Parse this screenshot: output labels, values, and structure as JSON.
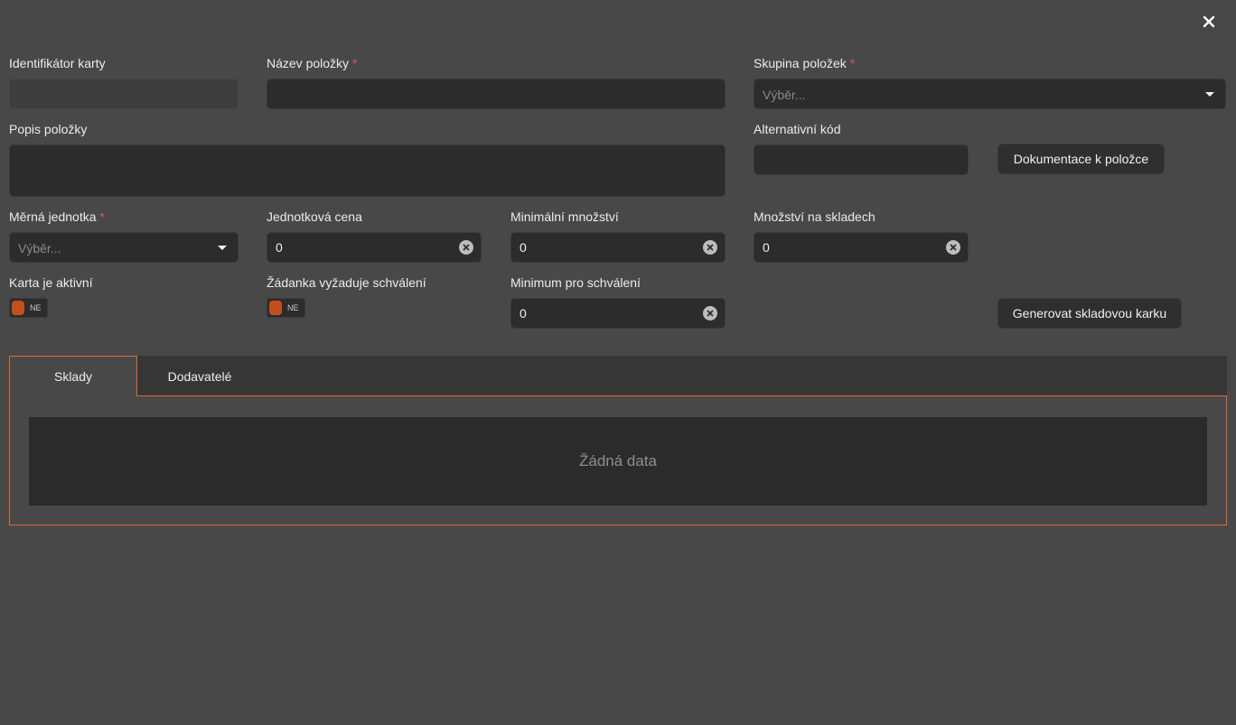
{
  "form": {
    "card_id": {
      "label": "Identifikátor karty",
      "value": ""
    },
    "item_name": {
      "label": "Název položky",
      "required_mark": "*",
      "value": ""
    },
    "item_group": {
      "label": "Skupina položek",
      "required_mark": "*",
      "placeholder": "Výběr..."
    },
    "item_description": {
      "label": "Popis položky",
      "value": ""
    },
    "alternative_code": {
      "label": "Alternativní kód",
      "value": ""
    },
    "documentation_button": "Dokumentace k položce",
    "unit": {
      "label": "Měrná jednotka",
      "required_mark": "*",
      "placeholder": "Výběr..."
    },
    "unit_price": {
      "label": "Jednotková cena",
      "value": "0"
    },
    "min_quantity": {
      "label": "Minimální množství",
      "value": "0"
    },
    "stock_quantity": {
      "label": "Množství na skladech",
      "value": "0"
    },
    "card_active": {
      "label": "Karta je aktivní",
      "toggle_text": "NE"
    },
    "requires_approval": {
      "label": "Žádanka vyžaduje schválení",
      "toggle_text": "NE"
    },
    "min_for_approval": {
      "label": "Minimum pro schválení",
      "value": "0"
    },
    "generate_button": "Generovat skladovou karku"
  },
  "tabs": [
    {
      "label": "Sklady",
      "active": true
    },
    {
      "label": "Dodavatelé",
      "active": false
    }
  ],
  "table": {
    "empty_text": "Žádná data"
  },
  "icons": {
    "close": "close-icon",
    "clear": "clear-circle-icon",
    "dropdown": "chevron-down-icon"
  },
  "colors": {
    "accent": "#e06a2e",
    "toggle_knob": "#c2501c",
    "required": "#e05050"
  }
}
